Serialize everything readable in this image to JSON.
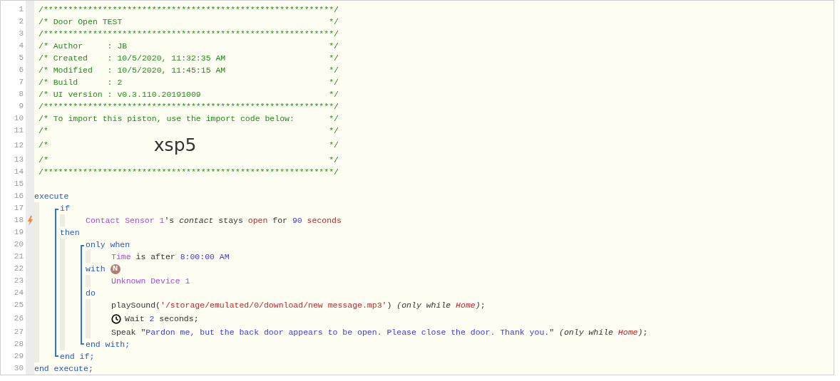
{
  "lines": [
    {
      "kind": "comment",
      "n": "1",
      "text": "/***********************************************************/"
    },
    {
      "kind": "comment",
      "n": "2",
      "text": "/* Door Open TEST",
      "end": "*/"
    },
    {
      "kind": "comment",
      "n": "3",
      "text": "/***********************************************************/"
    },
    {
      "kind": "comment",
      "n": "4",
      "text": "/* Author     : JB",
      "end": "*/"
    },
    {
      "kind": "comment",
      "n": "5",
      "text": "/* Created    : 10/5/2020, 11:32:35 AM",
      "end": "*/"
    },
    {
      "kind": "comment",
      "n": "6",
      "text": "/* Modified   : 10/5/2020, 11:45:15 AM",
      "end": "*/"
    },
    {
      "kind": "comment",
      "n": "7",
      "text": "/* Build      : 2",
      "end": "*/"
    },
    {
      "kind": "comment",
      "n": "8",
      "text": "/* UI version : v0.3.110.20191009",
      "end": "*/"
    },
    {
      "kind": "comment",
      "n": "9",
      "text": "/***********************************************************/"
    },
    {
      "kind": "comment",
      "n": "10",
      "text": "/* To import this piston, use the import code below:",
      "end": "*/"
    },
    {
      "kind": "comment",
      "n": "11",
      "text": "/*",
      "end": "*/"
    },
    {
      "kind": "comment",
      "n": "12",
      "text": "/*",
      "code": "xsp5",
      "end": "*/"
    },
    {
      "kind": "comment",
      "n": "13",
      "text": "/*",
      "end": "*/"
    },
    {
      "kind": "comment",
      "n": "14",
      "text": "/***********************************************************/"
    },
    {
      "kind": "blank",
      "n": "15"
    },
    {
      "kind": "code",
      "n": "16",
      "trigger": false,
      "tokens": [
        {
          "kind": "keyword",
          "text": "execute"
        }
      ],
      "children": [
        {
          "kind": "bracket",
          "children": [
            {
              "kind": "code",
              "n": "17",
              "trigger": false,
              "tokens": [
                {
                  "kind": "keyword",
                  "text": "if"
                }
              ],
              "children": [
                {
                  "kind": "code",
                  "n": "18",
                  "trigger": true,
                  "tokens": [
                    {
                      "kind": "device",
                      "text": "Contact Sensor 1"
                    },
                    {
                      "kind": "plain",
                      "text": "'s "
                    },
                    {
                      "kind": "attribute",
                      "text": "contact"
                    },
                    {
                      "kind": "plain",
                      "text": " stays "
                    },
                    {
                      "kind": "value",
                      "text": "open"
                    },
                    {
                      "kind": "plain",
                      "text": " for "
                    },
                    {
                      "kind": "number",
                      "text": "90"
                    },
                    {
                      "kind": "value",
                      "text": " seconds"
                    }
                  ]
                }
              ]
            },
            {
              "kind": "code",
              "n": "19",
              "trigger": false,
              "tokens": [
                {
                  "kind": "keyword",
                  "text": "then"
                }
              ],
              "children": [
                {
                  "kind": "bracket",
                  "children": [
                    {
                      "kind": "code",
                      "n": "20",
                      "trigger": false,
                      "tokens": [
                        {
                          "kind": "keyword",
                          "text": "only when"
                        }
                      ],
                      "children": [
                        {
                          "kind": "code",
                          "n": "21",
                          "trigger": false,
                          "tokens": [
                            {
                              "kind": "device",
                              "text": "Time"
                            },
                            {
                              "kind": "plain",
                              "text": " is after "
                            },
                            {
                              "kind": "number",
                              "text": "8:00:00 AM"
                            }
                          ]
                        }
                      ]
                    },
                    {
                      "kind": "code",
                      "n": "22",
                      "trigger": false,
                      "tokens": [
                        {
                          "kind": "keyword",
                          "text": "with"
                        },
                        {
                          "kind": "badge",
                          "text": "N"
                        }
                      ],
                      "children": [
                        {
                          "kind": "code",
                          "n": "23",
                          "trigger": false,
                          "tokens": [
                            {
                              "kind": "device",
                              "text": "Unknown Device 1"
                            }
                          ]
                        }
                      ]
                    },
                    {
                      "kind": "code",
                      "n": "24",
                      "trigger": false,
                      "tokens": [
                        {
                          "kind": "keyword",
                          "text": "do"
                        }
                      ],
                      "children": [
                        {
                          "kind": "code",
                          "n": "25",
                          "trigger": false,
                          "tokens": [
                            {
                              "kind": "plain",
                              "text": "playSound("
                            },
                            {
                              "kind": "value",
                              "text": "'/storage/emulated/0/download/new message.mp3'"
                            },
                            {
                              "kind": "plain",
                              "text": ") "
                            },
                            {
                              "kind": "attribute",
                              "text": "(only while "
                            },
                            {
                              "kind": "value-italic",
                              "text": "Home"
                            },
                            {
                              "kind": "attribute",
                              "text": ")"
                            },
                            {
                              "kind": "plain",
                              "text": ";"
                            }
                          ]
                        },
                        {
                          "kind": "code",
                          "n": "26",
                          "trigger": false,
                          "tokens": [
                            {
                              "kind": "clock"
                            },
                            {
                              "kind": "plain",
                              "text": "Wait "
                            },
                            {
                              "kind": "number",
                              "text": "2"
                            },
                            {
                              "kind": "plain",
                              "text": " seconds;"
                            }
                          ]
                        },
                        {
                          "kind": "code",
                          "n": "27",
                          "trigger": false,
                          "tokens": [
                            {
                              "kind": "plain",
                              "text": "Speak \""
                            },
                            {
                              "kind": "number",
                              "text": "Pardon me, but the back door appears to be open. Please close the door. Thank you."
                            },
                            {
                              "kind": "plain",
                              "text": "\" "
                            },
                            {
                              "kind": "attribute",
                              "text": "(only while "
                            },
                            {
                              "kind": "value-italic",
                              "text": "Home"
                            },
                            {
                              "kind": "attribute",
                              "text": ")"
                            },
                            {
                              "kind": "plain",
                              "text": ";"
                            }
                          ]
                        }
                      ]
                    },
                    {
                      "kind": "code",
                      "n": "28",
                      "trigger": false,
                      "tokens": [
                        {
                          "kind": "keyword",
                          "text": "end with;"
                        }
                      ]
                    }
                  ]
                }
              ]
            },
            {
              "kind": "code",
              "n": "29",
              "trigger": false,
              "tokens": [
                {
                  "kind": "keyword",
                  "text": "end if;"
                }
              ]
            }
          ]
        }
      ]
    },
    {
      "kind": "code",
      "n": "30",
      "trigger": false,
      "tokens": [
        {
          "kind": "keyword",
          "text": "end execute;"
        }
      ]
    }
  ]
}
